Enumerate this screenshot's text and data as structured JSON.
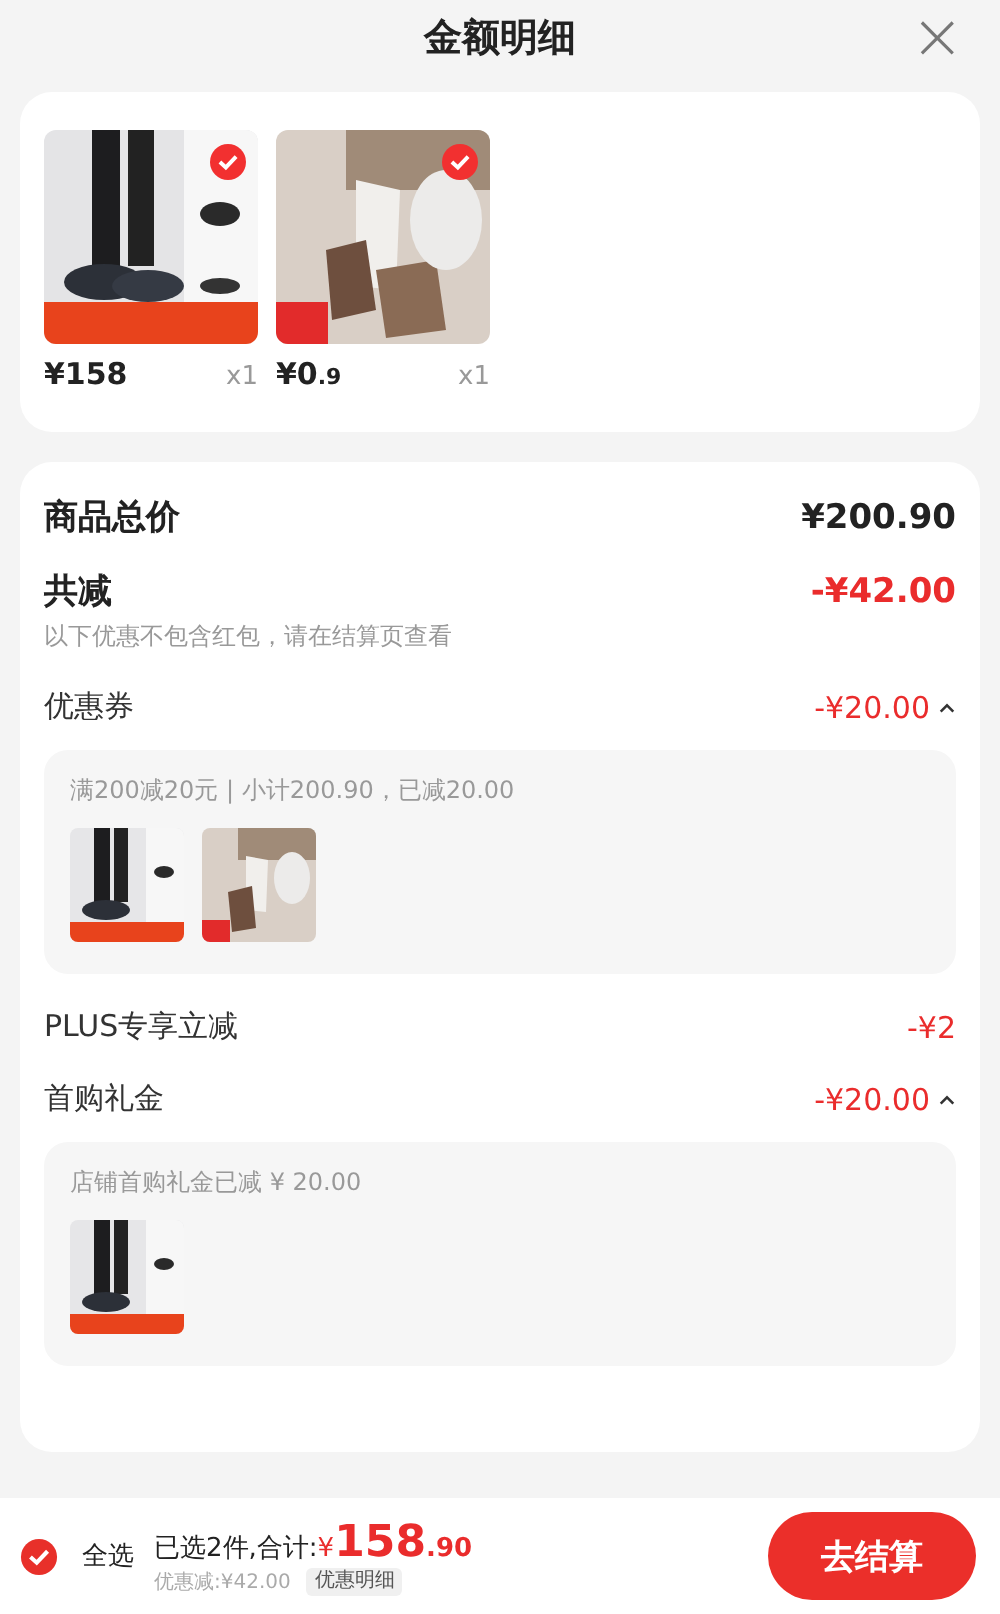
{
  "header": {
    "title": "金额明细",
    "close": "×"
  },
  "products": [
    {
      "kind": "shoe",
      "selected": true,
      "price": "¥158",
      "quantity": "x1"
    },
    {
      "kind": "socks",
      "selected": true,
      "price": "¥0",
      "price_decimal": ".9",
      "quantity": "x1"
    }
  ],
  "summary": {
    "total_label": "商品总价",
    "total_value": "¥200.90",
    "discount_label": "共减",
    "discount_value": "-¥42.00",
    "note": "以下优惠不包含红包，请在结算页查看"
  },
  "discounts": [
    {
      "kind": "expandable",
      "label": "优惠券",
      "value": "-¥20.00",
      "expanded": true,
      "detail": "满200减20元 | 小计200.90，已减20.00",
      "thumbs": [
        {
          "kind": "shoe"
        },
        {
          "kind": "socks"
        }
      ]
    },
    {
      "kind": "plain",
      "label": "PLUS专享立减",
      "value": "-¥2"
    },
    {
      "kind": "expandable",
      "label": "首购礼金",
      "value": "-¥20.00",
      "expanded": true,
      "detail": "店铺首购礼金已减 ¥ 20.00",
      "thumbs": [
        {
          "kind": "shoe"
        }
      ]
    }
  ],
  "footer": {
    "select_all_checked": true,
    "select_all": "全选",
    "total_label": "已选2件,合计:",
    "currency": "¥",
    "integer": "158",
    "decimal": ".90",
    "saved": "优惠减:¥42.00",
    "details_tag": "优惠明细",
    "checkout": "去结算"
  }
}
